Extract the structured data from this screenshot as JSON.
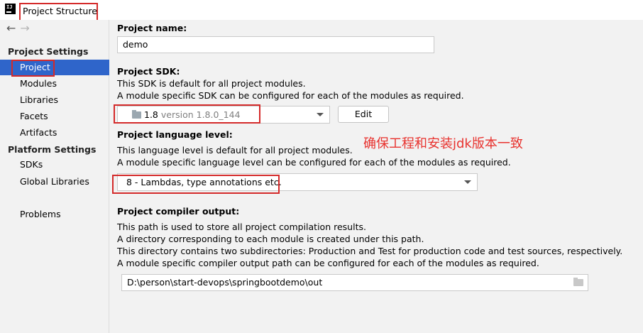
{
  "window": {
    "app_icon": "IJ",
    "title": "Project Structure"
  },
  "nav": {
    "back": "←",
    "forward": "→"
  },
  "sidebar": {
    "groups": [
      {
        "header": "Project Settings",
        "items": [
          "Project",
          "Modules",
          "Libraries",
          "Facets",
          "Artifacts"
        ]
      },
      {
        "header": "Platform Settings",
        "items": [
          "SDKs",
          "Global Libraries"
        ]
      }
    ],
    "problems": "Problems",
    "selected": "Project"
  },
  "project_name": {
    "label": "Project name:",
    "value": "demo"
  },
  "project_sdk": {
    "label": "Project SDK:",
    "desc1": "This SDK is default for all project modules.",
    "desc2": "A module specific SDK can be configured for each of the modules as required.",
    "selected_name": "1.8",
    "selected_version": "version 1.8.0_144",
    "edit_label": "Edit"
  },
  "language_level": {
    "label": "Project language level:",
    "desc1": "This language level is default for all project modules.",
    "desc2": "A module specific language level can be configured for each of the modules as required.",
    "value": "8 - Lambdas, type annotations etc."
  },
  "compiler_output": {
    "label": "Project compiler output:",
    "desc1": "This path is used to store all project compilation results.",
    "desc2": "A directory corresponding to each module is created under this path.",
    "desc3": "This directory contains two subdirectories: Production and Test for production code and test sources, respectively.",
    "desc4": "A module specific compiler output path can be configured for each of the modules as required.",
    "path": "D:\\person\\start-devops\\springbootdemo\\out"
  },
  "annotation": {
    "text": "确保工程和安装jdk版本一致",
    "color": "#e8332f"
  },
  "colors": {
    "selection": "#2f65ca",
    "highlight_box": "#d42a2a"
  }
}
